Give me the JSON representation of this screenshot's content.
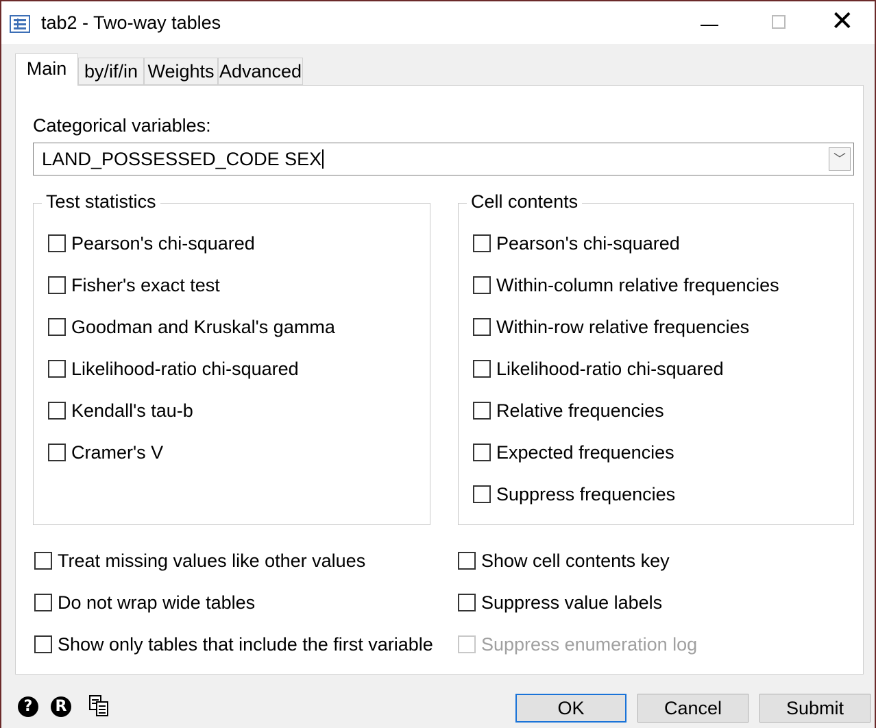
{
  "window": {
    "title": "tab2 - Two-way tables",
    "icon": "dialog-form-icon",
    "controls": [
      "minimize-icon",
      "maximize-icon",
      "close-icon"
    ]
  },
  "tabs": [
    {
      "label": "Main",
      "active": true
    },
    {
      "label": "by/if/in",
      "active": false
    },
    {
      "label": "Weights",
      "active": false
    },
    {
      "label": "Advanced",
      "active": false
    }
  ],
  "main": {
    "variables_label": "Categorical variables:",
    "variables_value": "LAND_POSSESSED_CODE SEX",
    "test_statistics": {
      "title": "Test statistics",
      "options": [
        {
          "label": "Pearson's chi-squared",
          "checked": false
        },
        {
          "label": "Fisher's exact test",
          "checked": false
        },
        {
          "label": "Goodman and Kruskal's gamma",
          "checked": false
        },
        {
          "label": "Likelihood-ratio chi-squared",
          "checked": false
        },
        {
          "label": "Kendall's tau-b",
          "checked": false
        },
        {
          "label": "Cramer's V",
          "checked": false
        }
      ]
    },
    "cell_contents": {
      "title": "Cell contents",
      "options": [
        {
          "label": "Pearson's chi-squared",
          "checked": false
        },
        {
          "label": "Within-column relative frequencies",
          "checked": false
        },
        {
          "label": "Within-row relative frequencies",
          "checked": false
        },
        {
          "label": "Likelihood-ratio chi-squared",
          "checked": false
        },
        {
          "label": "Relative frequencies",
          "checked": false
        },
        {
          "label": "Expected frequencies",
          "checked": false
        },
        {
          "label": "Suppress frequencies",
          "checked": false
        }
      ]
    },
    "bottom_left": [
      {
        "label": "Treat missing values like other values",
        "checked": false
      },
      {
        "label": "Do not wrap wide tables",
        "checked": false
      },
      {
        "label": "Show only tables that include the first variable",
        "checked": false
      }
    ],
    "bottom_right": [
      {
        "label": "Show cell contents key",
        "checked": false
      },
      {
        "label": "Suppress value labels",
        "checked": false
      },
      {
        "label": "Suppress enumeration log",
        "checked": false,
        "disabled": true
      }
    ]
  },
  "footer": {
    "help_icon": "?",
    "reset_icon": "R",
    "ok_label": "OK",
    "cancel_label": "Cancel",
    "submit_label": "Submit"
  },
  "colors": {
    "frame": "#6b2a2a",
    "default_button_border": "#1a73d8",
    "icon_blue": "#3d6fb6"
  }
}
